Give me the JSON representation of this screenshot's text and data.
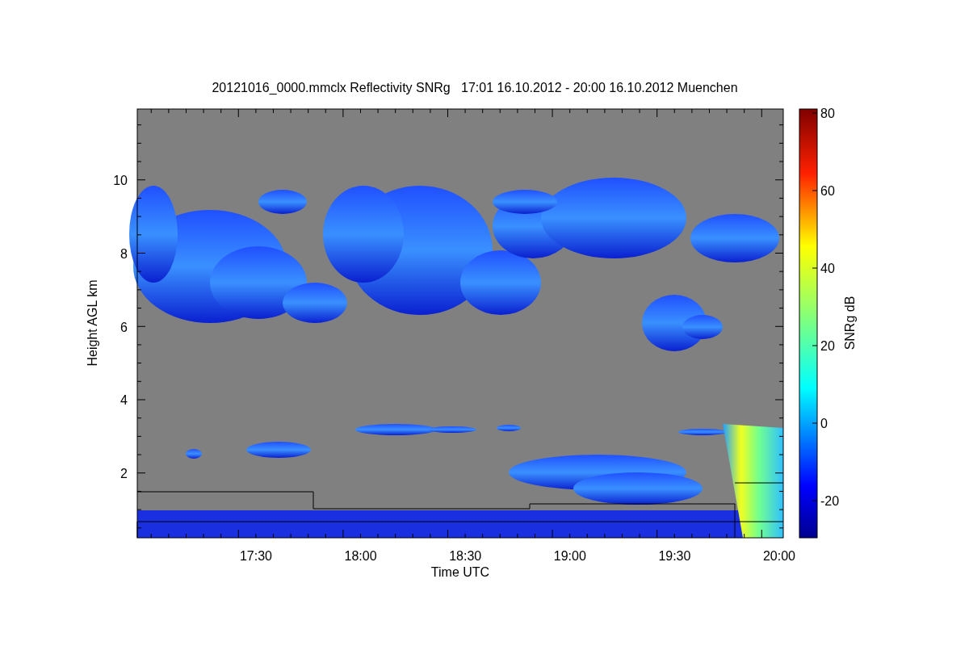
{
  "title": "20121016_0000.mmclx Reflectivity SNRg   17:01 16.10.2012 - 20:00 16.10.2012 Muenchen",
  "plot": {
    "xlabel": "Time UTC",
    "ylabel": "Height AGL km",
    "xticks": [
      "17:30",
      "18:00",
      "18:30",
      "19:00",
      "19:30",
      "20:00"
    ],
    "yticks": [
      "10",
      "8",
      "6",
      "4",
      "2"
    ]
  },
  "colorbar": {
    "label": "SNRg dB",
    "ticks": [
      "80",
      "60",
      "40",
      "20",
      "0",
      "-20"
    ]
  }
}
